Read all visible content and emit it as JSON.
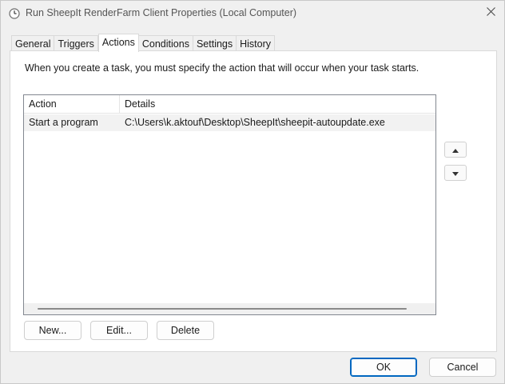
{
  "window": {
    "title": "Run SheepIt RenderFarm Client Properties (Local Computer)"
  },
  "tabs": [
    {
      "label": "General"
    },
    {
      "label": "Triggers"
    },
    {
      "label": "Actions"
    },
    {
      "label": "Conditions"
    },
    {
      "label": "Settings"
    },
    {
      "label": "History"
    }
  ],
  "active_tab": "Actions",
  "actions_panel": {
    "description": "When you create a task, you must specify the action that will occur when your task starts.",
    "columns": [
      "Action",
      "Details"
    ],
    "rows": [
      {
        "action": "Start a program",
        "details": "C:\\Users\\k.aktouf\\Desktop\\SheepIt\\sheepit-autoupdate.exe"
      }
    ],
    "new_label": "New...",
    "edit_label": "Edit...",
    "delete_label": "Delete"
  },
  "footer": {
    "ok_label": "OK",
    "cancel_label": "Cancel"
  },
  "icons": {
    "title": "task-scheduler-clock-icon",
    "close": "close-icon",
    "move_up": "chevron-up-icon",
    "move_down": "chevron-down-icon"
  },
  "colors": {
    "accent": "#0067c0",
    "selected_row": "#f2f2f2",
    "background": "#f0f0f0"
  }
}
